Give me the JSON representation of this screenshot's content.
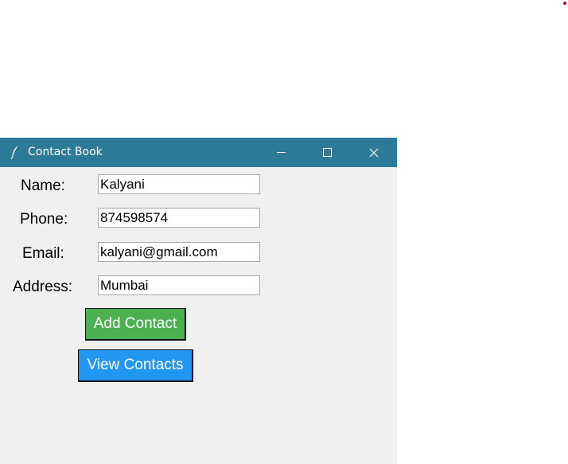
{
  "window": {
    "title": "Contact Book",
    "titlebar_color": "#2b7a98",
    "icons": {
      "app": "feather-icon",
      "minimize": "minimize-icon",
      "maximize": "maximize-icon",
      "close": "close-icon"
    }
  },
  "form": {
    "name_label": "Name:",
    "name_value": "Kalyani",
    "phone_label": "Phone:",
    "phone_value": "874598574",
    "email_label": "Email:",
    "email_value": "kalyani@gmail.com",
    "address_label": "Address:",
    "address_value": "Mumbai"
  },
  "buttons": {
    "add_label": "Add Contact",
    "add_color": "#4caf50",
    "view_label": "View Contacts",
    "view_color": "#2196f3"
  },
  "close_glyph": "✕"
}
